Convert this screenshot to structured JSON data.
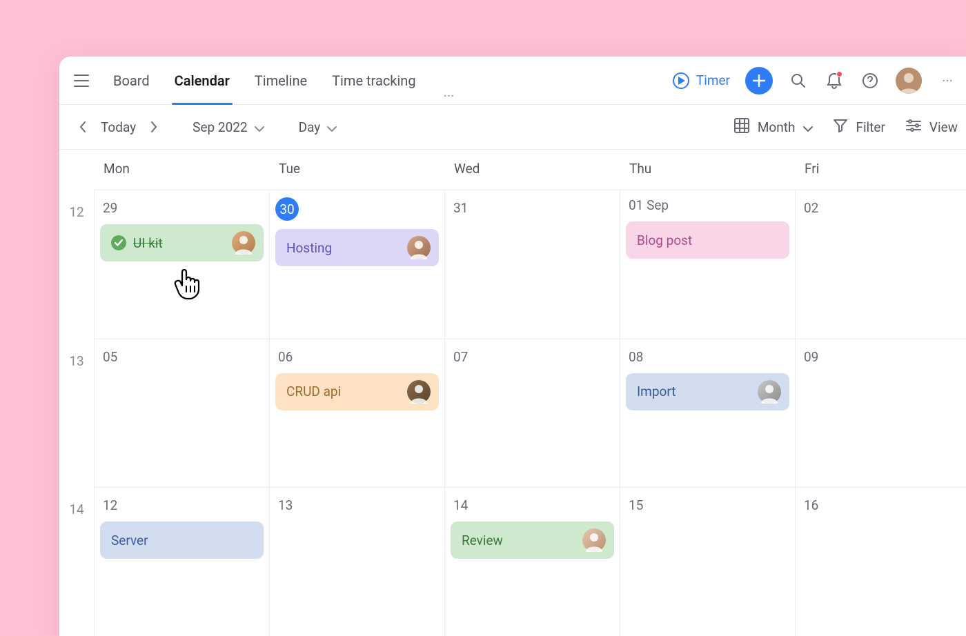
{
  "nav": {
    "tabs": [
      "Board",
      "Calendar",
      "Timeline",
      "Time tracking"
    ],
    "active_index": 1,
    "timer_label": "Timer"
  },
  "toolbar": {
    "today_label": "Today",
    "month_label": "Sep 2022",
    "timeframe_label": "Day",
    "view_mode_label": "Month",
    "filter_label": "Filter",
    "view_label": "View"
  },
  "calendar": {
    "day_headers": [
      "Mon",
      "Tue",
      "Wed",
      "Thu",
      "Fri"
    ],
    "weeks": [
      {
        "week_num": "12",
        "days": [
          {
            "num": "29",
            "events": [
              {
                "title": "UI kit",
                "color": "green",
                "done": true,
                "avatar": "c1"
              }
            ]
          },
          {
            "num": "30",
            "highlight": true,
            "events": [
              {
                "title": "Hosting",
                "color": "purple",
                "avatar": "c2"
              }
            ]
          },
          {
            "num": "31",
            "events": []
          },
          {
            "num": "01 Sep",
            "events": [
              {
                "title": "Blog post",
                "color": "pink"
              }
            ]
          },
          {
            "num": "02",
            "events": []
          }
        ]
      },
      {
        "week_num": "13",
        "days": [
          {
            "num": "05",
            "events": []
          },
          {
            "num": "06",
            "events": [
              {
                "title": "CRUD api",
                "color": "orange",
                "avatar": "c3"
              }
            ]
          },
          {
            "num": "07",
            "events": []
          },
          {
            "num": "08",
            "events": [
              {
                "title": "Import",
                "color": "blue",
                "avatar": "c4"
              }
            ]
          },
          {
            "num": "09",
            "events": []
          }
        ]
      },
      {
        "week_num": "14",
        "days": [
          {
            "num": "12",
            "events": [
              {
                "title": "Server",
                "color": "blue"
              }
            ]
          },
          {
            "num": "13",
            "events": []
          },
          {
            "num": "14",
            "events": [
              {
                "title": "Review",
                "color": "green",
                "avatar": "c5"
              }
            ]
          },
          {
            "num": "15",
            "events": []
          },
          {
            "num": "16",
            "events": []
          }
        ]
      }
    ]
  }
}
